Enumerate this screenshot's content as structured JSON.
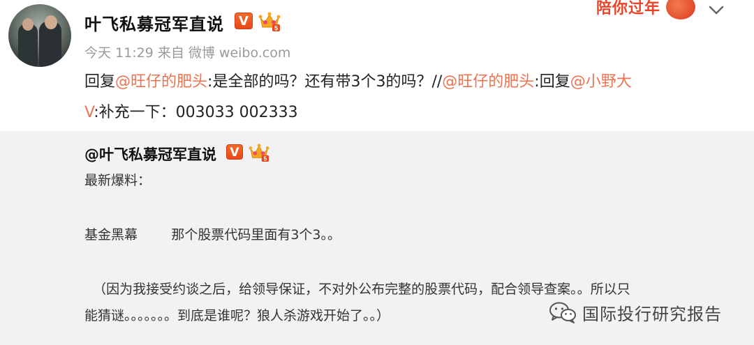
{
  "post": {
    "author": "叶飞私募冠军直说",
    "v_label": "V",
    "meta": "今天 11:29 来自 微博 weibo.com",
    "content_parts": {
      "p1": "回复",
      "m1": "@旺仔的肥头",
      "p2": ":是全部的吗？还有带3个3的吗？//",
      "m2": "@旺仔的肥头",
      "p3": ":回复",
      "m3": "@小野大",
      "m3b": "V",
      "p4": ":补充一下：003033 002333"
    },
    "banner_text": "陪你过年"
  },
  "repost": {
    "author": "@叶飞私募冠军直说",
    "v_label": "V",
    "line1": "最新爆料：",
    "line2": "基金黑幕        那个股票代码里面有3个3。。",
    "line3": "  （因为我接受约谈之后，给领导保证，不对外公布完整的股票代码，配合领导查案。。所以只",
    "line4": "能猜谜。。。。。。。到底是谁呢？狼人杀游戏开始了。。）"
  },
  "watermark": {
    "text": "国际投行研究报告"
  },
  "colors": {
    "mention": "#eb7350",
    "badge_orange": "#e8481b",
    "repost_bg": "#f2f2f5"
  },
  "icons": {
    "verified": "v-badge-icon",
    "member": "crown-icon",
    "expand": "chevron-down-icon",
    "wechat": "wechat-icon"
  }
}
